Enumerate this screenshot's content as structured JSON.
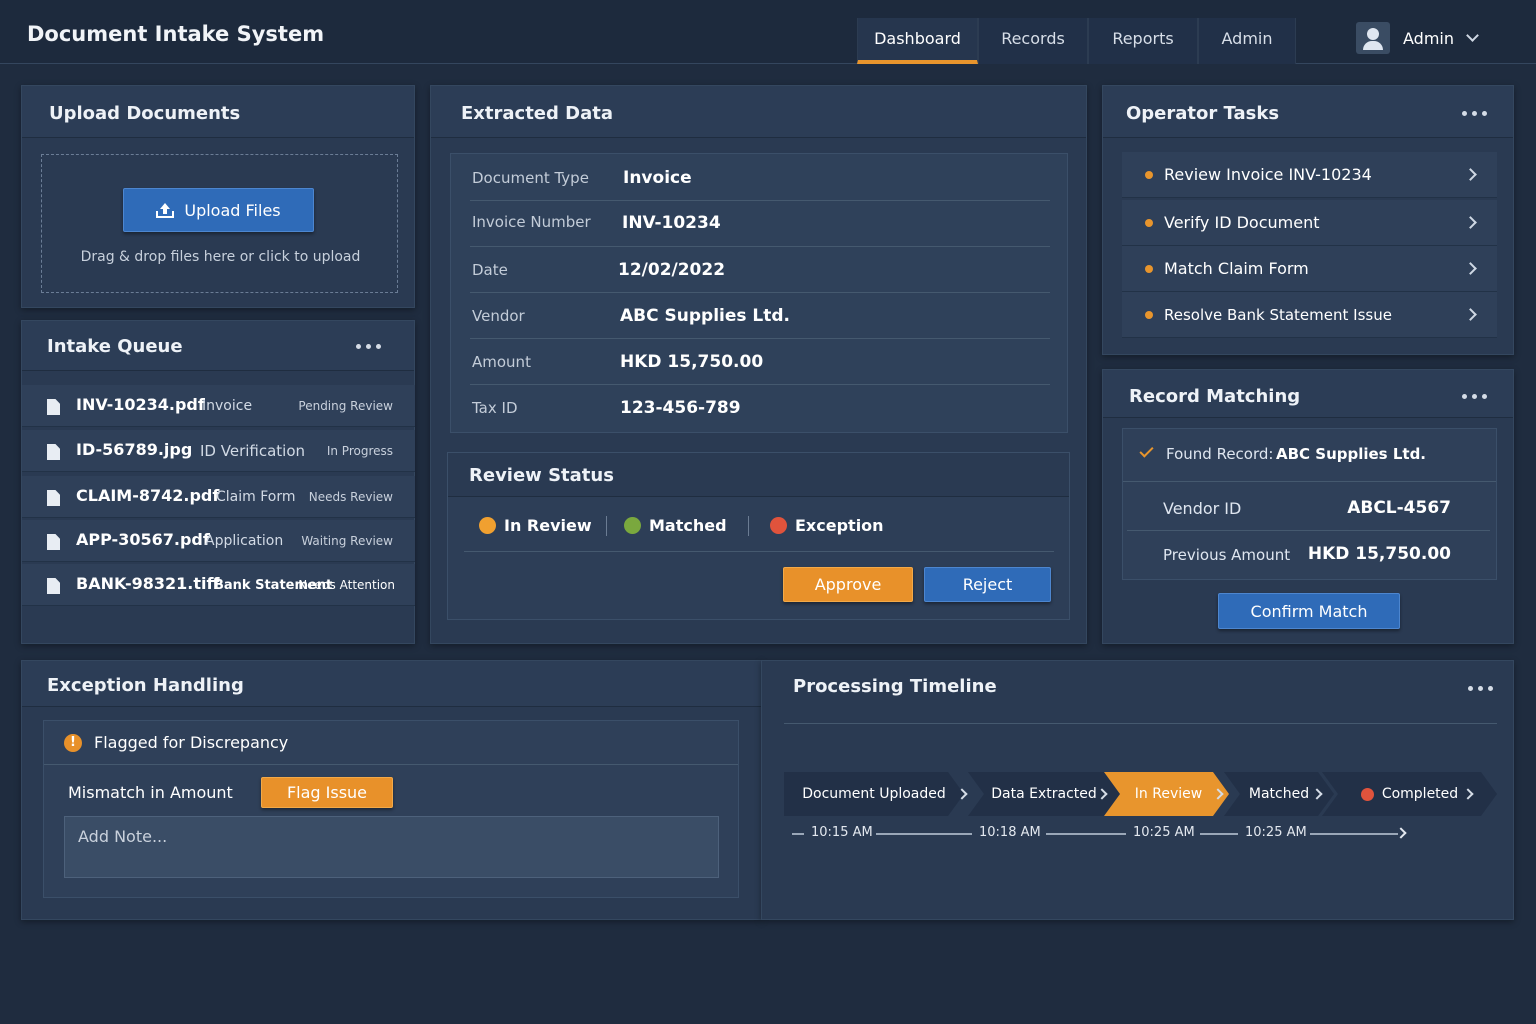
{
  "app": {
    "title": "Document Intake System",
    "nav": [
      "Dashboard",
      "Records",
      "Reports",
      "Admin"
    ],
    "active_tab": "Dashboard",
    "user": "Admin",
    "accent_color": "#e8952d",
    "primary_color": "#2f6bb8"
  },
  "upload": {
    "title": "Upload Documents",
    "button": "Upload Files",
    "hint": "Drag & drop files here or click to upload",
    "icon": "upload-icon"
  },
  "queue": {
    "title": "Intake Queue",
    "rows": [
      {
        "file": "INV-10234.pdf",
        "type": "Invoice",
        "status": "Pending Review"
      },
      {
        "file": "ID-56789.jpg",
        "type": "ID Verification",
        "status": "In Progress"
      },
      {
        "file": "CLAIM-8742.pdf",
        "type": "Claim Form",
        "status": "Needs Review"
      },
      {
        "file": "APP-30567.pdf",
        "type": "Application",
        "status": "Waiting Review"
      },
      {
        "file": "BANK-98321.tiff",
        "type": "Bank Statement",
        "status": "Needs Attention"
      }
    ]
  },
  "extracted": {
    "title": "Extracted Data",
    "fields": [
      {
        "label": "Document Type",
        "value": "Invoice"
      },
      {
        "label": "Invoice Number",
        "value": "INV-10234"
      },
      {
        "label": "Date",
        "value": "12/02/2022"
      },
      {
        "label": "Vendor",
        "value": "ABC Supplies Ltd."
      },
      {
        "label": "Amount",
        "value": "HKD 15,750.00"
      },
      {
        "label": "Tax ID",
        "value": "123-456-789"
      }
    ]
  },
  "review": {
    "title": "Review Status",
    "statuses": [
      {
        "label": "In Review",
        "color": "#f0a030"
      },
      {
        "label": "Matched",
        "color": "#7aa83e"
      },
      {
        "label": "Exception",
        "color": "#e0533c"
      }
    ],
    "approve": "Approve",
    "reject": "Reject"
  },
  "tasks": {
    "title": "Operator Tasks",
    "items": [
      "Review Invoice INV-10234",
      "Verify ID Document",
      "Match Claim Form",
      "Resolve Bank Statement Issue"
    ]
  },
  "matching": {
    "title": "Record Matching",
    "found_label": "Found Record:",
    "found_value": "ABC Supplies Ltd.",
    "rows": [
      {
        "label": "Vendor ID",
        "value": "ABCL-4567"
      },
      {
        "label": "Previous Amount",
        "value": "HKD 15,750.00"
      }
    ],
    "confirm": "Confirm Match"
  },
  "exception": {
    "title": "Exception Handling",
    "flag_title": "Flagged for Discrepancy",
    "mismatch": "Mismatch in Amount",
    "flag_button": "Flag Issue",
    "note_placeholder": "Add Note..."
  },
  "timeline": {
    "title": "Processing Timeline",
    "steps": [
      "Document Uploaded",
      "Data Extracted",
      "In Review",
      "Matched",
      "Completed"
    ],
    "active_step": "In Review",
    "times": [
      "10:15 AM",
      "10:18 AM",
      "10:25 AM",
      "10:25 AM"
    ]
  }
}
